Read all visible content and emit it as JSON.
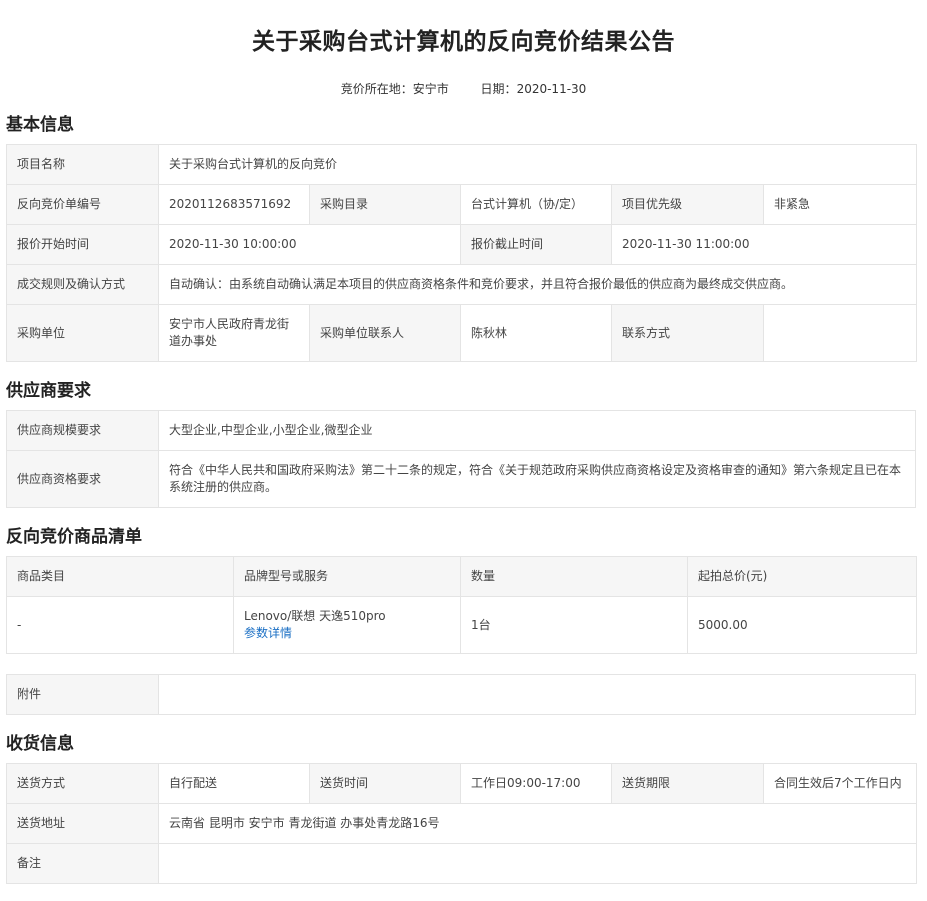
{
  "header": {
    "title": "关于采购台式计算机的反向竞价结果公告",
    "location_label": "竞价所在地：",
    "location_value": "安宁市",
    "date_label": "日期：",
    "date_value": "2020-11-30"
  },
  "basic": {
    "section_title": "基本信息",
    "project_name_label": "项目名称",
    "project_name_value": "关于采购台式计算机的反向竞价",
    "bid_no_label": "反向竞价单编号",
    "bid_no_value": "2020112683571692",
    "catalog_label": "采购目录",
    "catalog_value": "台式计算机（协/定）",
    "priority_label": "项目优先级",
    "priority_value": "非紧急",
    "start_label": "报价开始时间",
    "start_value": "2020-11-30 10:00:00",
    "end_label": "报价截止时间",
    "end_value": "2020-11-30 11:00:00",
    "rule_label": "成交规则及确认方式",
    "rule_value": "自动确认：由系统自动确认满足本项目的供应商资格条件和竞价要求，并且符合报价最低的供应商为最终成交供应商。",
    "unit_label": "采购单位",
    "unit_value": "安宁市人民政府青龙街道办事处",
    "contact_label": "采购单位联系人",
    "contact_value": "陈秋林",
    "phone_label": "联系方式",
    "phone_value": ""
  },
  "supplier": {
    "section_title": "供应商要求",
    "scale_label": "供应商规模要求",
    "scale_value": "大型企业,中型企业,小型企业,微型企业",
    "qual_label": "供应商资格要求",
    "qual_value": "符合《中华人民共和国政府采购法》第二十二条的规定，符合《关于规范政府采购供应商资格设定及资格审查的通知》第六条规定且已在本系统注册的供应商。"
  },
  "goods": {
    "section_title": "反向竞价商品清单",
    "headers": [
      "商品类目",
      "品牌型号或服务",
      "数量",
      "起拍总价(元)"
    ],
    "rows": [
      {
        "category": "-",
        "brand": "Lenovo/联想 天逸510pro",
        "detail_link": "参数详情",
        "qty": "1台",
        "price": "5000.00"
      }
    ]
  },
  "attachment": {
    "label": "附件",
    "value": ""
  },
  "delivery": {
    "section_title": "收货信息",
    "method_label": "送货方式",
    "method_value": "自行配送",
    "time_label": "送货时间",
    "time_value": "工作日09:00-17:00",
    "period_label": "送货期限",
    "period_value": "合同生效后7个工作日内",
    "address_label": "送货地址",
    "address_value": "云南省 昆明市 安宁市 青龙街道 办事处青龙路16号",
    "remark_label": "备注",
    "remark_value": ""
  }
}
